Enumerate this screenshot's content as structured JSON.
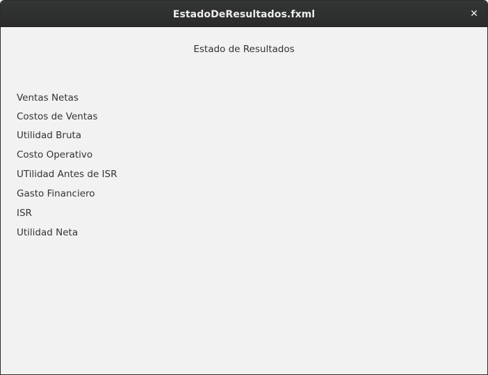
{
  "window": {
    "title": "EstadoDeResultados.fxml",
    "close_icon": "close-icon",
    "close_glyph": "✕"
  },
  "form": {
    "heading": "Estado de Resultados",
    "labels": [
      "Ventas Netas",
      "Costos de Ventas",
      "Utilidad Bruta",
      "Costo Operativo",
      "UTilidad Antes de ISR",
      "Gasto Financiero",
      "ISR",
      "Utilidad Neta"
    ]
  }
}
